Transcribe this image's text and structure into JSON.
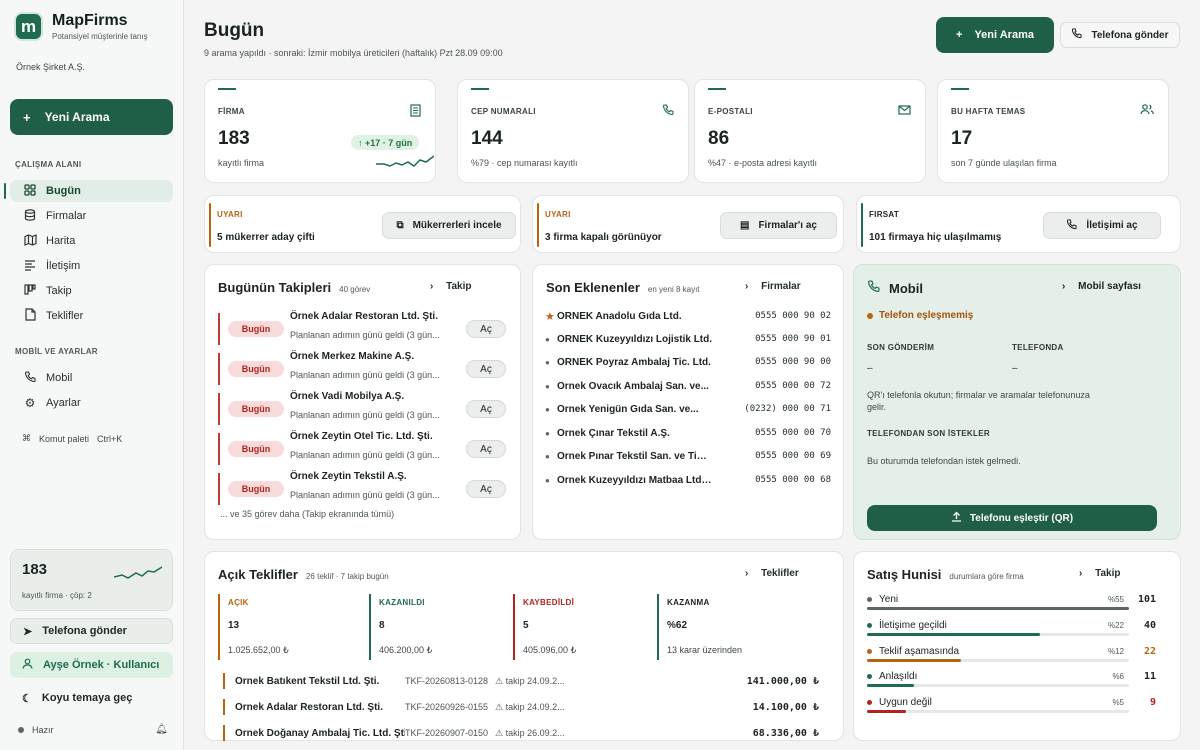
{
  "brand": {
    "name": "MapFirms",
    "tagline": "Potansiyel müşterinle tanış",
    "logo_letter": "m"
  },
  "company": "Örnek Şirket A.Ş.",
  "sidebar": {
    "new_search": "Yeni Arama",
    "section_work": "ÇALIŞMA ALANI",
    "items": [
      {
        "label": "Bugün",
        "icon": "grid-icon"
      },
      {
        "label": "Firmalar",
        "icon": "database-icon"
      },
      {
        "label": "Harita",
        "icon": "map-icon"
      },
      {
        "label": "İletişim",
        "icon": "list-icon"
      },
      {
        "label": "Takip",
        "icon": "kanban-icon"
      },
      {
        "label": "Teklifler",
        "icon": "document-icon"
      }
    ],
    "section_mobile": "MOBİL VE AYARLAR",
    "mobile_items": [
      {
        "label": "Mobil",
        "icon": "phone-icon"
      },
      {
        "label": "Ayarlar",
        "icon": "gear-icon"
      }
    ],
    "command_palette": "Komut paleti",
    "command_shortcut": "Ctrl+K",
    "mini_stat": {
      "value": "183",
      "caption": "kayıtlı firma · çöp: 2"
    },
    "send_to_phone": "Telefona gönder",
    "user": "Ayşe Örnek · Kullanıcı",
    "theme": "Koyu temaya geç",
    "status": "Hazır"
  },
  "header": {
    "title": "Bugün",
    "subtitle": "9 arama yapıldı · sonraki: İzmir mobilya üreticileri (haftalık) Pzt 28.09 09:00",
    "new_search": "Yeni Arama",
    "send_to_phone": "Telefona gönder"
  },
  "kpis": [
    {
      "label": "FİRMA",
      "value": "183",
      "caption": "kayıtlı firma",
      "badge": "↑ +17 · 7 gün",
      "icon": "building-icon"
    },
    {
      "label": "CEP NUMARALI",
      "value": "144",
      "caption": "%79 · cep numarası kayıtlı",
      "icon": "phone-icon"
    },
    {
      "label": "E-POSTALI",
      "value": "86",
      "caption": "%47 · e-posta adresi kayıtlı",
      "icon": "mail-icon"
    },
    {
      "label": "BU HAFTA TEMAS",
      "value": "17",
      "caption": "son 7 günde ulaşılan firma",
      "icon": "users-icon"
    }
  ],
  "alerts": [
    {
      "tag": "UYARI",
      "text": "5 mükerrer aday çifti",
      "button": "Mükerrerleri incele",
      "color": "#b9630f"
    },
    {
      "tag": "UYARI",
      "text": "3 firma kapalı görünüyor",
      "button": "Firmalar'ı aç",
      "color": "#b9630f"
    },
    {
      "tag": "FIRSAT",
      "text": "101 firmaya hiç ulaşılmamış",
      "button": "İletişimi aç",
      "color": "#1f6b50"
    }
  ],
  "followups": {
    "title": "Bugünün Takipleri",
    "count": "40 görev",
    "link": "Takip",
    "items": [
      {
        "badge": "Bugün",
        "name": "Örnek Adalar Restoran Ltd. Şti.",
        "desc": "Planlanan adımın günü geldi (3 gün...",
        "action": "Aç"
      },
      {
        "badge": "Bugün",
        "name": "Örnek Merkez Makine A.Ş.",
        "desc": "Planlanan adımın günü geldi (3 gün...",
        "action": "Aç"
      },
      {
        "badge": "Bugün",
        "name": "Örnek Vadi Mobilya A.Ş.",
        "desc": "Planlanan adımın günü geldi (3 gün...",
        "action": "Aç"
      },
      {
        "badge": "Bugün",
        "name": "Örnek Zeytin Otel Tic. Ltd. Şti.",
        "desc": "Planlanan adımın günü geldi (3 gün...",
        "action": "Aç"
      },
      {
        "badge": "Bugün",
        "name": "Örnek Zeytin Tekstil A.Ş.",
        "desc": "Planlanan adımın günü geldi (3 gün...",
        "action": "Aç"
      }
    ],
    "more": "... ve 35 görev daha (Takip ekranında tümü)"
  },
  "recent": {
    "title": "Son Eklenenler",
    "count": "en yeni 8 kayıt",
    "link": "Firmalar",
    "items": [
      {
        "name": "ÖRNEK Anadolu Gıda Ltd.",
        "phone": "0555 000 90 02",
        "starred": true
      },
      {
        "name": "ÖRNEK Kuzeyyıldızı Lojistik Ltd.",
        "phone": "0555 000 90 01",
        "starred": false
      },
      {
        "name": "ÖRNEK Poyraz Ambalaj Tic. Ltd.",
        "phone": "0555 000 90 00",
        "starred": false
      },
      {
        "name": "Örnek Ovacık Ambalaj San. ve...",
        "phone": "0555 000 00 72",
        "starred": false
      },
      {
        "name": "Örnek Yenigün Gıda San. ve...",
        "phone": "(0232) 000 00 71",
        "starred": false
      },
      {
        "name": "Örnek Çınar Tekstil A.Ş.",
        "phone": "0555 000 00 70",
        "starred": false
      },
      {
        "name": "Örnek Pınar Tekstil San. ve Tic....",
        "phone": "0555 000 00 69",
        "starred": false
      },
      {
        "name": "Örnek Kuzeyyıldızı Matbaa Ltd....",
        "phone": "0555 000 00 68",
        "starred": false
      }
    ]
  },
  "mobile": {
    "title": "Mobil",
    "link": "Mobil sayfası",
    "status": "Telefon eşleşmemiş",
    "last_sent_label": "SON GÖNDERİM",
    "last_sent_value": "–",
    "on_phone_label": "TELEFONDA",
    "on_phone_value": "–",
    "help": "QR'ı telefonla okutun; firmalar ve aramalar telefonunuza gelir.",
    "requests_label": "TELEFONDAN SON İSTEKLER",
    "requests_text": "Bu oturumda telefondan istek gelmedi.",
    "pair_button": "Telefonu eşleştir (QR)"
  },
  "offers": {
    "title": "Açık Teklifler",
    "count": "26 teklif · 7 takip bugün",
    "link": "Teklifler",
    "stats": [
      {
        "label": "AÇIK",
        "value": "13",
        "sub": "1.025.652,00 ₺",
        "color": "#b9630f"
      },
      {
        "label": "KAZANILDI",
        "value": "8",
        "sub": "406.200,00 ₺",
        "color": "#1f6b50"
      },
      {
        "label": "KAYBEDİLDİ",
        "value": "5",
        "sub": "405.096,00 ₺",
        "color": "#b3231f"
      },
      {
        "label": "KAZANMA",
        "value": "%62",
        "sub": "13 karar üzerinden",
        "color": "#1f6b50"
      }
    ],
    "items": [
      {
        "name": "Örnek Batıkent Tekstil Ltd. Şti.",
        "code": "TKF-20260813-0128",
        "follow": "takip 24.09.2...",
        "amount": "141.000,00 ₺"
      },
      {
        "name": "Örnek Adalar Restoran Ltd. Şti.",
        "code": "TKF-20260926-0155",
        "follow": "takip 24.09.2...",
        "amount": "14.100,00 ₺"
      },
      {
        "name": "Örnek Doğanay Ambalaj Tic. Ltd. Şti.",
        "code": "TKF-20260907-0150",
        "follow": "takip 26.09.2...",
        "amount": "68.336,00 ₺"
      }
    ]
  },
  "funnel": {
    "title": "Satış Hunisi",
    "count": "durumlara göre firma",
    "link": "Takip",
    "stages": [
      {
        "label": "Yeni",
        "pct_label": "%55",
        "value": "101",
        "fraction": 0.55,
        "color": "#5d6762"
      },
      {
        "label": "İletişime geçildi",
        "pct_label": "%22",
        "value": "40",
        "fraction": 0.22,
        "color": "#1f6b50"
      },
      {
        "label": "Teklif aşamasında",
        "pct_label": "%12",
        "value": "22",
        "fraction": 0.12,
        "color": "#b9630f"
      },
      {
        "label": "Anlaşıldı",
        "pct_label": "%6",
        "value": "11",
        "fraction": 0.06,
        "color": "#1f6b50"
      },
      {
        "label": "Uygun değil",
        "pct_label": "%5",
        "value": "9",
        "fraction": 0.05,
        "color": "#b3231f"
      }
    ]
  }
}
